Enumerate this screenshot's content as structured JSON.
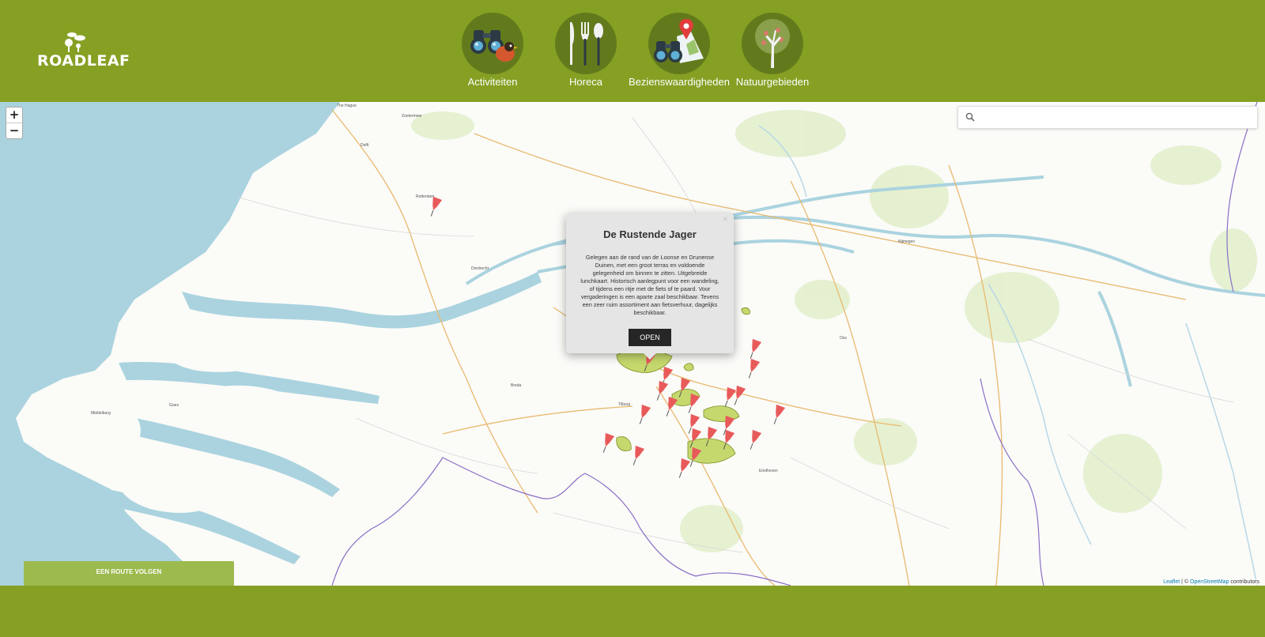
{
  "brand": {
    "name": "ROADLEAF"
  },
  "nav": [
    {
      "label": "Activiteiten",
      "icon": "binoculars-bird-icon"
    },
    {
      "label": "Horeca",
      "icon": "cutlery-icon"
    },
    {
      "label": "Bezienswaardigheden",
      "icon": "binoculars-map-pin-icon"
    },
    {
      "label": "Natuurgebieden",
      "icon": "tree-icon"
    }
  ],
  "map": {
    "zoom_in": "+",
    "zoom_out": "−",
    "search": {
      "placeholder": "",
      "value": ""
    },
    "popup": {
      "title": "De Rustende Jager",
      "close": "×",
      "description": "Gelegen aan de rand van de Loonse en Drunense Duinen, met een groot terras en voldoende gelegenheid om binnen te zitten. Uitgebreide lunchkaart. Historisch aanlegpunt voor een wandeling, of tijdens een ritje met de fiets of te paard. Voor vergaderingen is een aparte zaal beschikbaar. Tevens een zeer ruim assortiment aan fietsverhuur, dagelijks beschikbaar.",
      "button": "OPEN"
    },
    "place_labels": [
      "The Hague",
      "Zoetermeer",
      "Delft",
      "Rotterdam",
      "Dordrecht",
      "Breda",
      "Tilburg",
      "Eindhoven",
      "Nijmegen",
      "Middelburg",
      "Goes",
      "Oss"
    ],
    "route_button": "EEN ROUTE VOLGEN",
    "attribution": {
      "leaflet": "Leaflet",
      "separator": " | © ",
      "osm": "OpenStreetMap",
      "suffix": " contributors"
    }
  },
  "colors": {
    "header_bg": "#86a024",
    "nav_circle": "#637a1c",
    "water": "#aad3df",
    "marker": "#e85a5a",
    "nature_area": "#c5d86d",
    "route_button": "#9dba4e"
  }
}
